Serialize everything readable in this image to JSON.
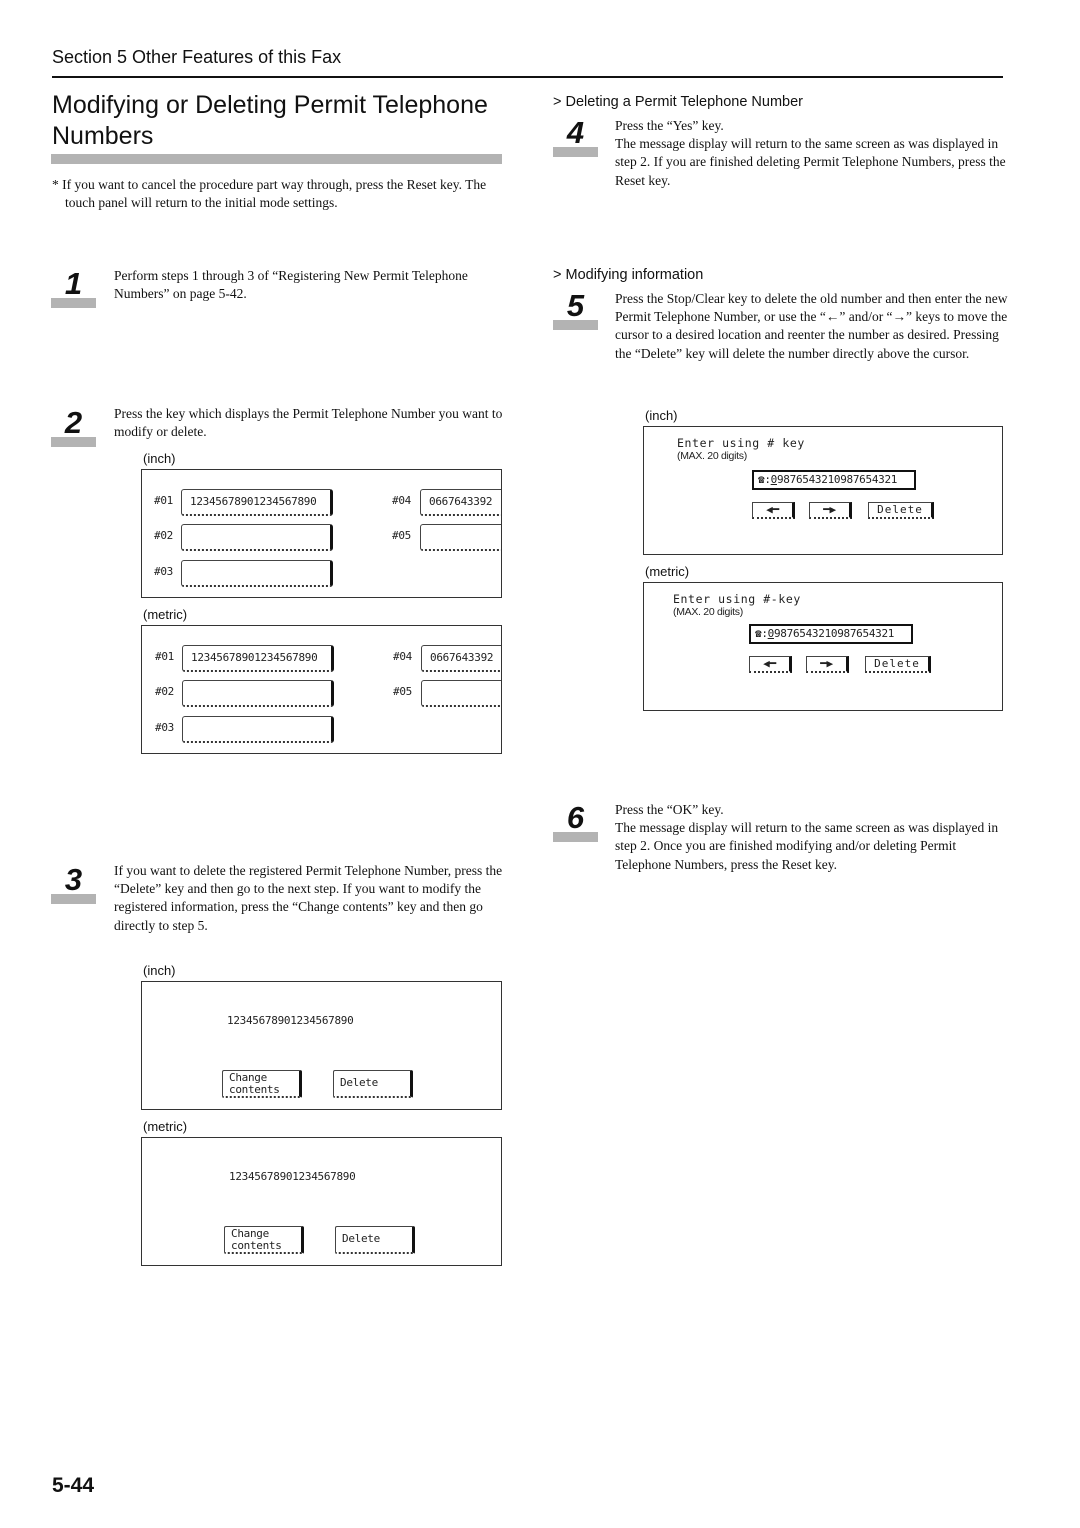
{
  "header": {
    "section": "Section 5  Other Features of this Fax",
    "title": "Modifying or Deleting Permit Telephone Numbers"
  },
  "note": "* If you want to cancel the procedure part way through, press the Reset key. The touch panel will return to the initial mode settings.",
  "steps": [
    {
      "number": "1",
      "text": "Perform steps 1 through 3 of “Registering New Permit Telephone Numbers” on page 5-42."
    },
    {
      "number": "2",
      "text": "Press the key which displays the Permit Telephone Number you want to modify or delete."
    },
    {
      "number": "3",
      "text": "If you want to delete the registered Permit Telephone Number, press the “Delete” key and then go to the next step. If you want to modify the registered information, press the “Change contents” key and then go directly to step 5."
    },
    {
      "number": "4",
      "text": "Press the “Yes” key.\nThe message display will return to the same screen as was displayed in step 2. If you are finished deleting Permit Telephone Numbers, press the Reset key."
    },
    {
      "number": "5",
      "text": "Press the Stop/Clear key to delete the old number and then enter the new Permit Telephone Number, or use the “←” and/or “→” keys to move the cursor to a desired location and reenter the number as desired. Pressing the “Delete” key will delete the number directly above the cursor."
    },
    {
      "number": "6",
      "text": "Press the “OK” key.\nThe message display will return to the same screen as was displayed in step 2. Once you are finished modifying and/or deleting Permit Telephone Numbers, press the Reset key."
    }
  ],
  "subheads": {
    "deleting": "> Deleting a Permit Telephone Number",
    "modifying": "> Modifying information"
  },
  "units": {
    "inch": "(inch)",
    "metric": "(metric)"
  },
  "step2_panel": {
    "slots": [
      {
        "label": "#01",
        "value": "12345678901234567890"
      },
      {
        "label": "#02",
        "value": ""
      },
      {
        "label": "#03",
        "value": ""
      },
      {
        "label": "#04",
        "value": "0667643392"
      },
      {
        "label": "#05",
        "value": ""
      }
    ]
  },
  "step3_panel": {
    "number": "12345678901234567890",
    "change_line1": "Change",
    "change_line2": "contents",
    "delete": "Delete"
  },
  "step5_panel": {
    "prompt_inch": "Enter using # key",
    "prompt_metric": "Enter using #-key",
    "max": "(MAX. 20 digits)",
    "phone_icon": "☎",
    "cursor_digit": "0",
    "number_rest": "9876543210987654321",
    "left_arrow": "◀━",
    "right_arrow": "━▶",
    "delete": "Delete"
  },
  "page_number": "5-44"
}
